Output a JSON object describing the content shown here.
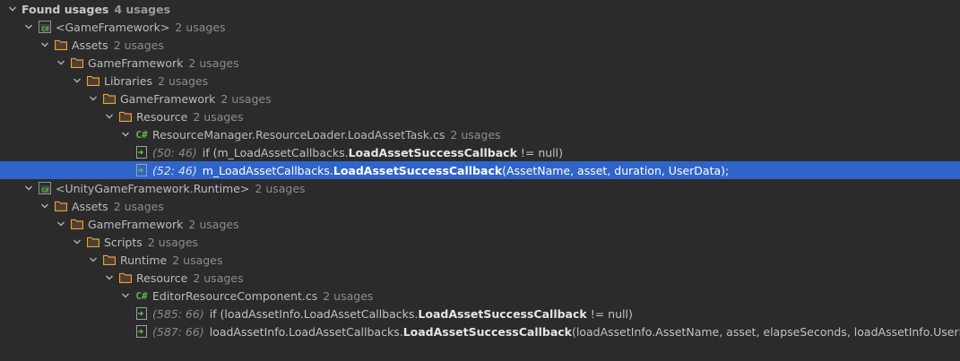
{
  "header": {
    "title": "Found usages",
    "count": "4 usages"
  },
  "nodes": [
    {
      "depth": 0,
      "kind": "project",
      "label": "<GameFramework>",
      "usages": "2 usages"
    },
    {
      "depth": 1,
      "kind": "folder",
      "label": "Assets",
      "usages": "2 usages"
    },
    {
      "depth": 2,
      "kind": "folder",
      "label": "GameFramework",
      "usages": "2 usages"
    },
    {
      "depth": 3,
      "kind": "folder",
      "label": "Libraries",
      "usages": "2 usages"
    },
    {
      "depth": 4,
      "kind": "folder",
      "label": "GameFramework",
      "usages": "2 usages"
    },
    {
      "depth": 5,
      "kind": "folder",
      "label": "Resource",
      "usages": "2 usages"
    },
    {
      "depth": 6,
      "kind": "csfile",
      "label": "ResourceManager.ResourceLoader.LoadAssetTask.cs",
      "usages": "2 usages"
    },
    {
      "depth": 7,
      "kind": "usage",
      "loc": "(50: 46)",
      "pre": "if (m_LoadAssetCallbacks.",
      "match": "LoadAssetSuccessCallback",
      "post": " != null)"
    },
    {
      "depth": 7,
      "kind": "usage",
      "selected": true,
      "loc": "(52: 46)",
      "pre": "m_LoadAssetCallbacks.",
      "match": "LoadAssetSuccessCallback",
      "post": "(AssetName, asset, duration, UserData);"
    },
    {
      "depth": 0,
      "kind": "project",
      "label": "<UnityGameFramework.Runtime>",
      "usages": "2 usages"
    },
    {
      "depth": 1,
      "kind": "folder",
      "label": "Assets",
      "usages": "2 usages"
    },
    {
      "depth": 2,
      "kind": "folder",
      "label": "GameFramework",
      "usages": "2 usages"
    },
    {
      "depth": 3,
      "kind": "folder",
      "label": "Scripts",
      "usages": "2 usages"
    },
    {
      "depth": 4,
      "kind": "folder",
      "label": "Runtime",
      "usages": "2 usages"
    },
    {
      "depth": 5,
      "kind": "folder",
      "label": "Resource",
      "usages": "2 usages"
    },
    {
      "depth": 6,
      "kind": "csfile",
      "label": "EditorResourceComponent.cs",
      "usages": "2 usages"
    },
    {
      "depth": 7,
      "kind": "usage",
      "loc": "(585: 66)",
      "pre": "if (loadAssetInfo.LoadAssetCallbacks.",
      "match": "LoadAssetSuccessCallback",
      "post": " != null)"
    },
    {
      "depth": 7,
      "kind": "usage",
      "loc": "(587: 66)",
      "pre": "loadAssetInfo.LoadAssetCallbacks.",
      "match": "LoadAssetSuccessCallback",
      "post": "(loadAssetInfo.AssetName, asset, elapseSeconds, loadAssetInfo.UserData);"
    }
  ],
  "icons": {
    "chevron": "chevron-down-icon",
    "project": "csharp-project-icon",
    "folder": "folder-icon",
    "csfile": "csharp-file-icon",
    "usage": "usage-line-icon"
  },
  "colors": {
    "background": "#2b2b2b",
    "selection": "#2f65ca",
    "folder": "#e8a33d",
    "csharp": "#62b543"
  }
}
